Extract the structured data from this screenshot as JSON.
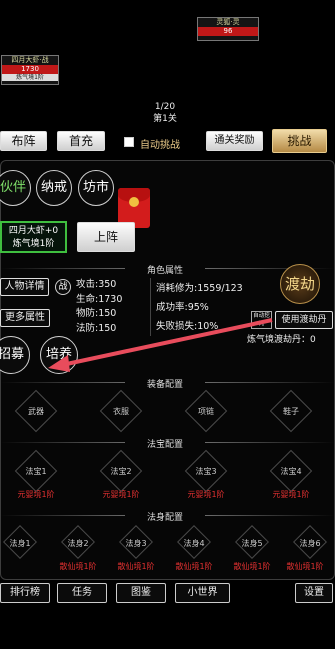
{
  "enemy": {
    "name": "灵狐·灵",
    "hp": "96"
  },
  "player_unit": {
    "name": "四月大虾·战",
    "hp": "1730",
    "sub": "炼气境1阶"
  },
  "wave": {
    "counter": "1/20",
    "level": "第1关"
  },
  "toolbar": {
    "formation": "布阵",
    "first_recharge": "首充",
    "auto_challenge": "自动挑战",
    "clear_reward": "通关奖励",
    "challenge": "挑战"
  },
  "nav": {
    "partner": "伙伴",
    "ring": "纳戒",
    "market": "坊市"
  },
  "char_card": {
    "name": "四月大虾+0",
    "realm": "炼气境1阶"
  },
  "deploy": "上阵",
  "attributes": {
    "header": "角色属性",
    "details": "人物详情",
    "zhan": "战",
    "more": "更多属性",
    "attack": "攻击:350",
    "life": "生命:1730",
    "phys_def": "物防:150",
    "magic_def": "法防:150",
    "cultivation": "消耗修为:1559/123",
    "success": "成功率:95%",
    "fail_loss": "失败损失:10%"
  },
  "tribulation": {
    "logo": "渡劫",
    "auto_tag": "自动挖死",
    "use_pill": "使用渡劫丹",
    "pill_count": "炼气境渡劫丹：0"
  },
  "actions": {
    "recruit": "招募",
    "cultivate": "培养"
  },
  "equipment": {
    "header": "装备配置",
    "slots": [
      "武器",
      "衣服",
      "项链",
      "鞋子"
    ]
  },
  "treasures": {
    "header": "法宝配置",
    "slots": [
      "法宝1",
      "法宝2",
      "法宝3",
      "法宝4"
    ],
    "realm": "元婴境1阶"
  },
  "avatars": {
    "header": "法身配置",
    "slots": [
      "法身1",
      "法身2",
      "法身3",
      "法身4",
      "法身5",
      "法身6"
    ],
    "realms": [
      "",
      "散仙境1阶",
      "散仙境1阶",
      "散仙境1阶",
      "散仙境1阶",
      "散仙境1阶"
    ]
  },
  "bottom": {
    "rank": "排行榜",
    "task": "任务",
    "codex": "图鉴",
    "world": "小世界",
    "settings": "设置"
  }
}
